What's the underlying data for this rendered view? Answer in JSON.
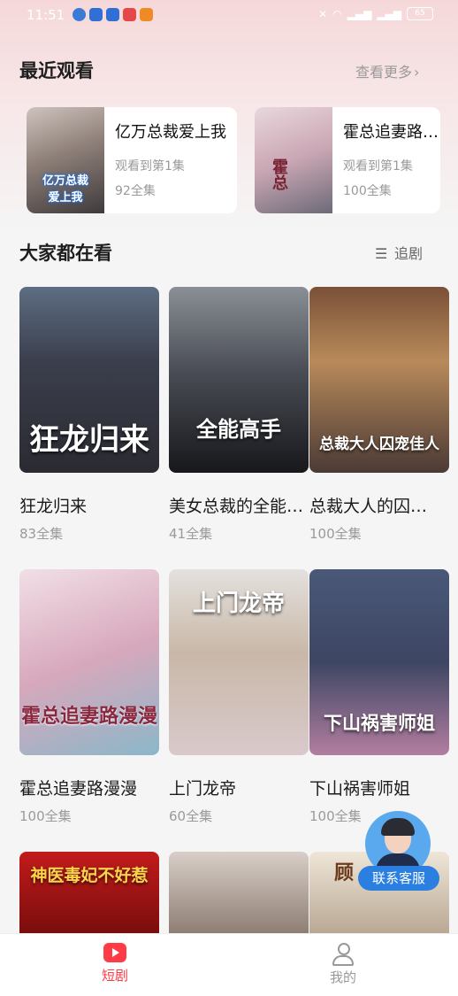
{
  "status_bar": {
    "time": "11:51",
    "battery": "65"
  },
  "recent": {
    "title": "最近观看",
    "more_label": "查看更多",
    "items": [
      {
        "title": "亿万总裁爱上我",
        "progress": "观看到第1集",
        "episodes": "92全集"
      },
      {
        "title": "霍总追妻路漫漫",
        "progress": "观看到第1集",
        "episodes": "100全集"
      }
    ]
  },
  "popular": {
    "title": "大家都在看",
    "follow_label": "追剧",
    "items": [
      {
        "title": "狂龙归来",
        "episodes": "83全集",
        "poster_text": "狂龙归来"
      },
      {
        "title": "美女总裁的全能高手",
        "episodes": "41全集",
        "poster_text": "全能高手"
      },
      {
        "title": "总裁大人的囚宠佳人",
        "episodes": "100全集",
        "poster_text": "总裁大人囚宠佳人"
      },
      {
        "title": "霍总追妻路漫漫",
        "episodes": "100全集",
        "poster_text": "霍总追妻路漫漫"
      },
      {
        "title": "上门龙帝",
        "episodes": "60全集",
        "poster_text": "上门龙帝"
      },
      {
        "title": "下山祸害师姐",
        "episodes": "100全集",
        "poster_text": "下山祸害师姐"
      },
      {
        "poster_text": "神医毒妃不好惹"
      },
      {
        "poster_text": ""
      },
      {
        "poster_text": "顾"
      }
    ]
  },
  "customer_service": {
    "label": "联系客服"
  },
  "tabs": [
    {
      "label": "短剧",
      "active": true
    },
    {
      "label": "我的",
      "active": false
    }
  ],
  "colors": {
    "accent": "#ff3b45",
    "text_secondary": "#9a9a9a"
  }
}
